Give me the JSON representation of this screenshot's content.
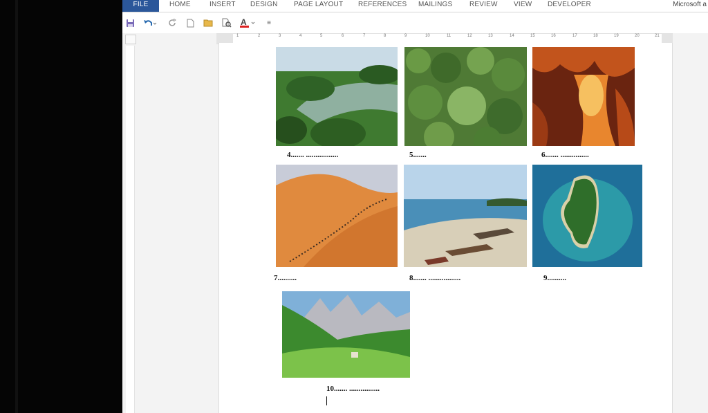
{
  "ribbon": {
    "tabs": [
      "FILE",
      "HOME",
      "INSERT",
      "DESIGN",
      "PAGE LAYOUT",
      "REFERENCES",
      "MAILINGS",
      "REVIEW",
      "VIEW",
      "DEVELOPER"
    ],
    "app_title": "Microsoft a"
  },
  "quick_access": [
    "save-icon",
    "undo-icon",
    "redo-icon",
    "new-document-icon",
    "open-icon",
    "print-preview-icon",
    "font-color-icon",
    "customize-icon"
  ],
  "ruler": {
    "numbers": [
      "1",
      "2",
      "3",
      "4",
      "5",
      "6",
      "7",
      "8",
      "9",
      "10",
      "11",
      "12",
      "13",
      "14",
      "15",
      "16",
      "17",
      "18",
      "19",
      "20",
      "21"
    ]
  },
  "document": {
    "captions": [
      {
        "id": "4",
        "text": "4....... ................."
      },
      {
        "id": "5",
        "text": "5......."
      },
      {
        "id": "6",
        "text": "6....... ..............."
      },
      {
        "id": "7",
        "text": "7.........."
      },
      {
        "id": "8",
        "text": "8....... ................."
      },
      {
        "id": "9",
        "text": "9.........."
      },
      {
        "id": "10",
        "text": "10....... ................"
      }
    ]
  }
}
